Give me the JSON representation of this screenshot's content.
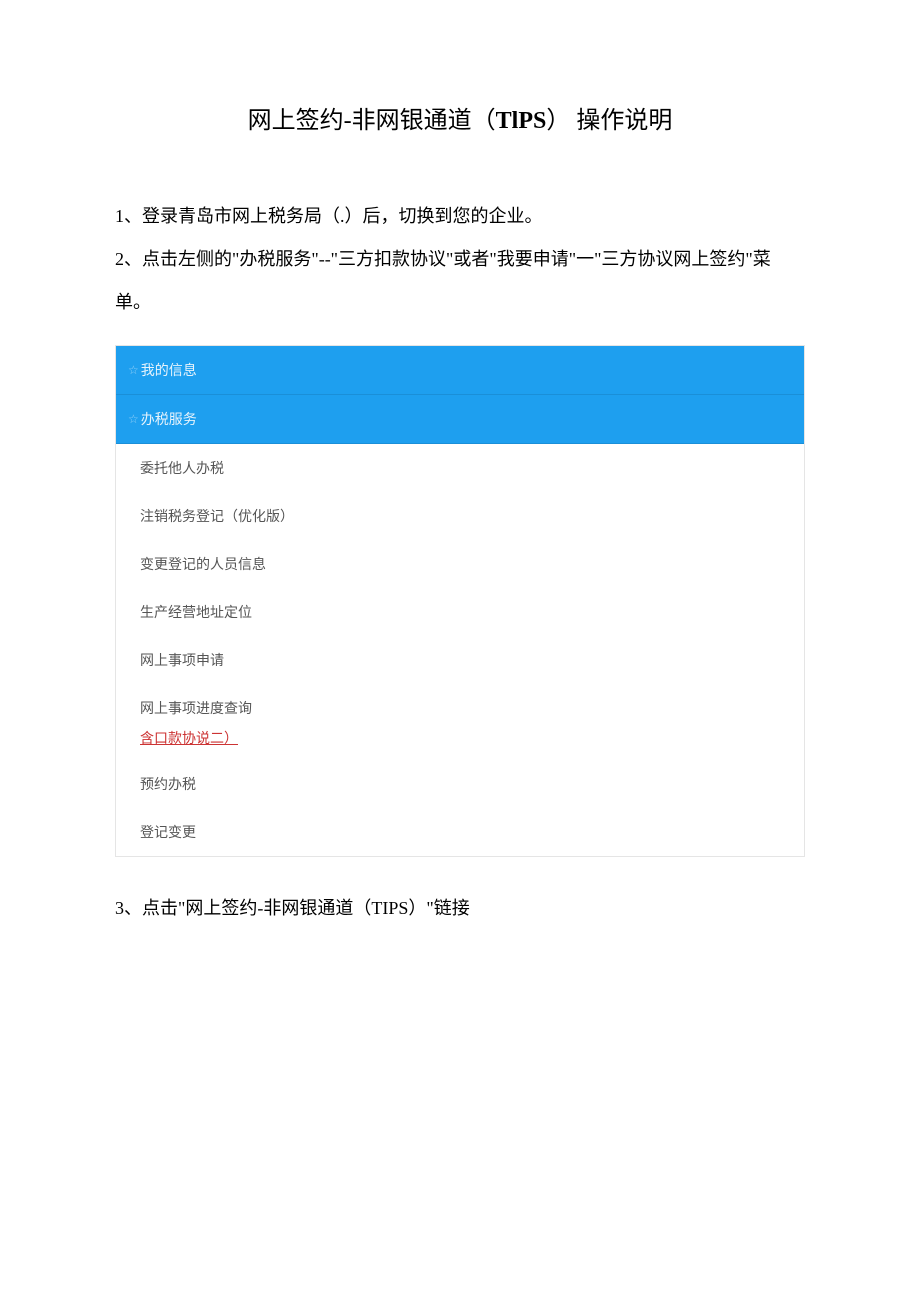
{
  "title": {
    "prefix": "网上签约-非网银通道（",
    "bold": "TlPS",
    "suffix": "） 操作说明"
  },
  "paragraphs": {
    "p1": "1、登录青岛市网上税务局（.）后，切换到您的企业。",
    "p2": "2、点击左侧的\"办税服务\"--\"三方扣款协议\"或者\"我要申请\"一\"三方协议网上签约\"菜单。",
    "p3": "3、点击\"网上签约-非网银通道（TIPS）\"链接"
  },
  "menu": {
    "headers": [
      "我的信息",
      "办税服务"
    ],
    "items": [
      "委托他人办税",
      "注销税务登记（优化版）",
      "变更登记的人员信息",
      "生产经营地址定位",
      "网上事项申请",
      "网上事项进度查询"
    ],
    "highlight": "含口款协说二）",
    "items_after": [
      "预约办税",
      "登记变更"
    ]
  }
}
